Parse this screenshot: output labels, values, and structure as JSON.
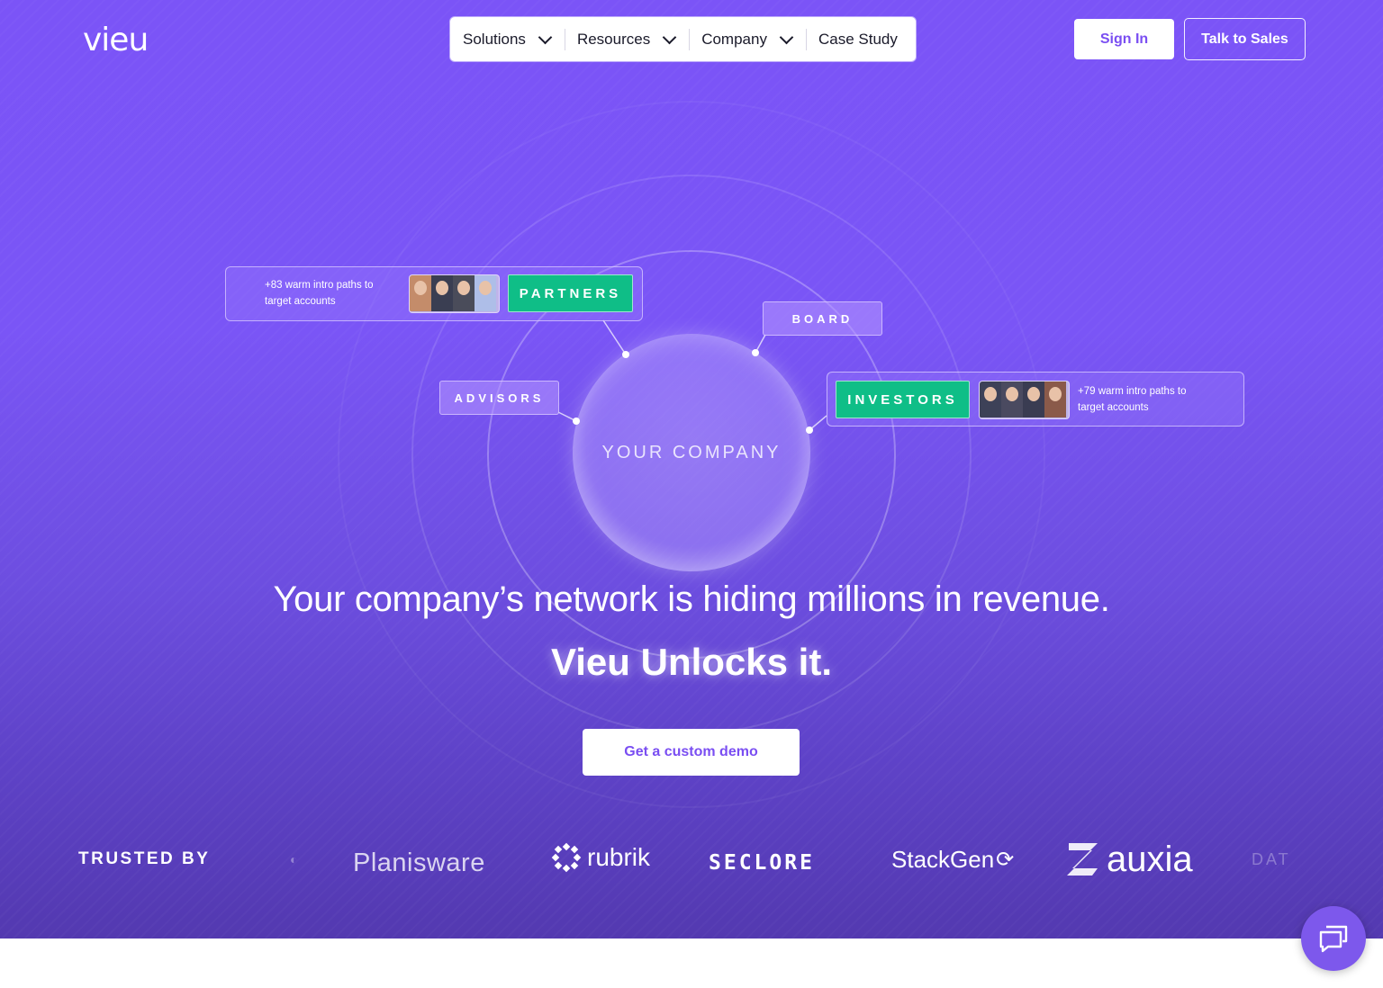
{
  "brand": {
    "name": "vieu"
  },
  "nav": {
    "items": [
      {
        "label": "Solutions",
        "has_menu": true
      },
      {
        "label": "Resources",
        "has_menu": true
      },
      {
        "label": "Company",
        "has_menu": true
      },
      {
        "label": "Case Study",
        "has_menu": false
      }
    ]
  },
  "header_actions": {
    "sign_in": "Sign In",
    "talk_to_sales": "Talk to Sales"
  },
  "diagram": {
    "center": "YOUR COMPANY",
    "nodes": {
      "partners": {
        "label": "PARTNERS",
        "note": "+83 warm intro paths to target accounts"
      },
      "board": {
        "label": "BOARD"
      },
      "advisors": {
        "label": "ADVISORS"
      },
      "investors": {
        "label": "INVESTORS",
        "note": "+79 warm intro paths to target accounts"
      }
    }
  },
  "hero": {
    "headline": "Your company’s network is hiding millions in revenue.",
    "subheadline": "Vieu Unlocks it.",
    "cta": "Get a custom demo"
  },
  "trusted": {
    "label": "TRUSTED BY",
    "logos": [
      "Planisware",
      "rubrik",
      "SECLORE",
      "StackGen",
      "auxia",
      "DAT"
    ]
  },
  "chat": {
    "icon": "chat-bubbles-icon"
  },
  "colors": {
    "accent": "#7a4ef2",
    "green": "#0fbe87",
    "hero_top": "#7b54f7",
    "hero_bottom": "#5339b0"
  }
}
